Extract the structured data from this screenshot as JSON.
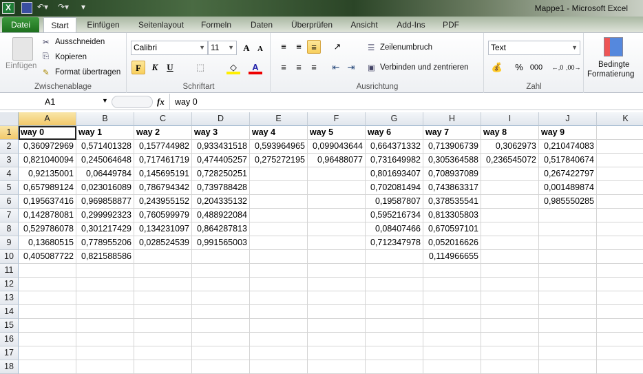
{
  "window": {
    "title": "Mappe1  -  Microsoft Excel"
  },
  "tabs": [
    "Datei",
    "Start",
    "Einfügen",
    "Seitenlayout",
    "Formeln",
    "Daten",
    "Überprüfen",
    "Ansicht",
    "Add-Ins",
    "PDF"
  ],
  "ribbon": {
    "clipboard": {
      "label": "Zwischenablage",
      "paste": "Einfügen",
      "cut": "Ausschneiden",
      "copy": "Kopieren",
      "format_painter": "Format übertragen"
    },
    "font": {
      "label": "Schriftart",
      "name": "Calibri",
      "size": "11",
      "bold": "F",
      "italic": "K",
      "underline": "U"
    },
    "alignment": {
      "label": "Ausrichtung",
      "wrap": "Zeilenumbruch",
      "merge": "Verbinden und zentrieren"
    },
    "number": {
      "label": "Zahl",
      "format": "Text",
      "percent": "%",
      "thousands": "000"
    },
    "styles": {
      "conditional_line1": "Bedingte",
      "conditional_line2": "Formatierung"
    }
  },
  "formula_bar": {
    "name_box": "A1",
    "fx": "fx",
    "value": "way 0"
  },
  "sheet": {
    "columns": [
      "A",
      "B",
      "C",
      "D",
      "E",
      "F",
      "G",
      "H",
      "I",
      "J",
      "K"
    ],
    "row_count": 18,
    "headers": [
      "way 0",
      "way 1",
      "way 2",
      "way 3",
      "way 4",
      "way 5",
      "way 6",
      "way 7",
      "way 8",
      "way 9"
    ],
    "data": [
      [
        "0,360972969",
        "0,571401328",
        "0,157744982",
        "0,933431518",
        "0,593964965",
        "0,099043644",
        "0,664371332",
        "0,713906739",
        "0,3062973",
        "0,210474083"
      ],
      [
        "0,821040094",
        "0,245064648",
        "0,717461719",
        "0,474405257",
        "0,275272195",
        "0,96488077",
        "0,731649982",
        "0,305364588",
        "0,236545072",
        "0,517840674"
      ],
      [
        "0,92135001",
        "0,06449784",
        "0,145695191",
        "0,728250251",
        "",
        "",
        "0,801693407",
        "0,708937089",
        "",
        "0,267422797"
      ],
      [
        "0,657989124",
        "0,023016089",
        "0,786794342",
        "0,739788428",
        "",
        "",
        "0,702081494",
        "0,743863317",
        "",
        "0,001489874"
      ],
      [
        "0,195637416",
        "0,969858877",
        "0,243955152",
        "0,204335132",
        "",
        "",
        "0,19587807",
        "0,378535541",
        "",
        "0,985550285"
      ],
      [
        "0,142878081",
        "0,299992323",
        "0,760599979",
        "0,488922084",
        "",
        "",
        "0,595216734",
        "0,813305803",
        "",
        ""
      ],
      [
        "0,529786078",
        "0,301217429",
        "0,134231097",
        "0,864287813",
        "",
        "",
        "0,08407466",
        "0,670597101",
        "",
        ""
      ],
      [
        "0,13680515",
        "0,778955206",
        "0,028524539",
        "0,991565003",
        "",
        "",
        "0,712347978",
        "0,052016626",
        "",
        ""
      ],
      [
        "0,405087722",
        "0,821588586",
        "",
        "",
        "",
        "",
        "",
        "0,114966655",
        "",
        ""
      ]
    ]
  }
}
